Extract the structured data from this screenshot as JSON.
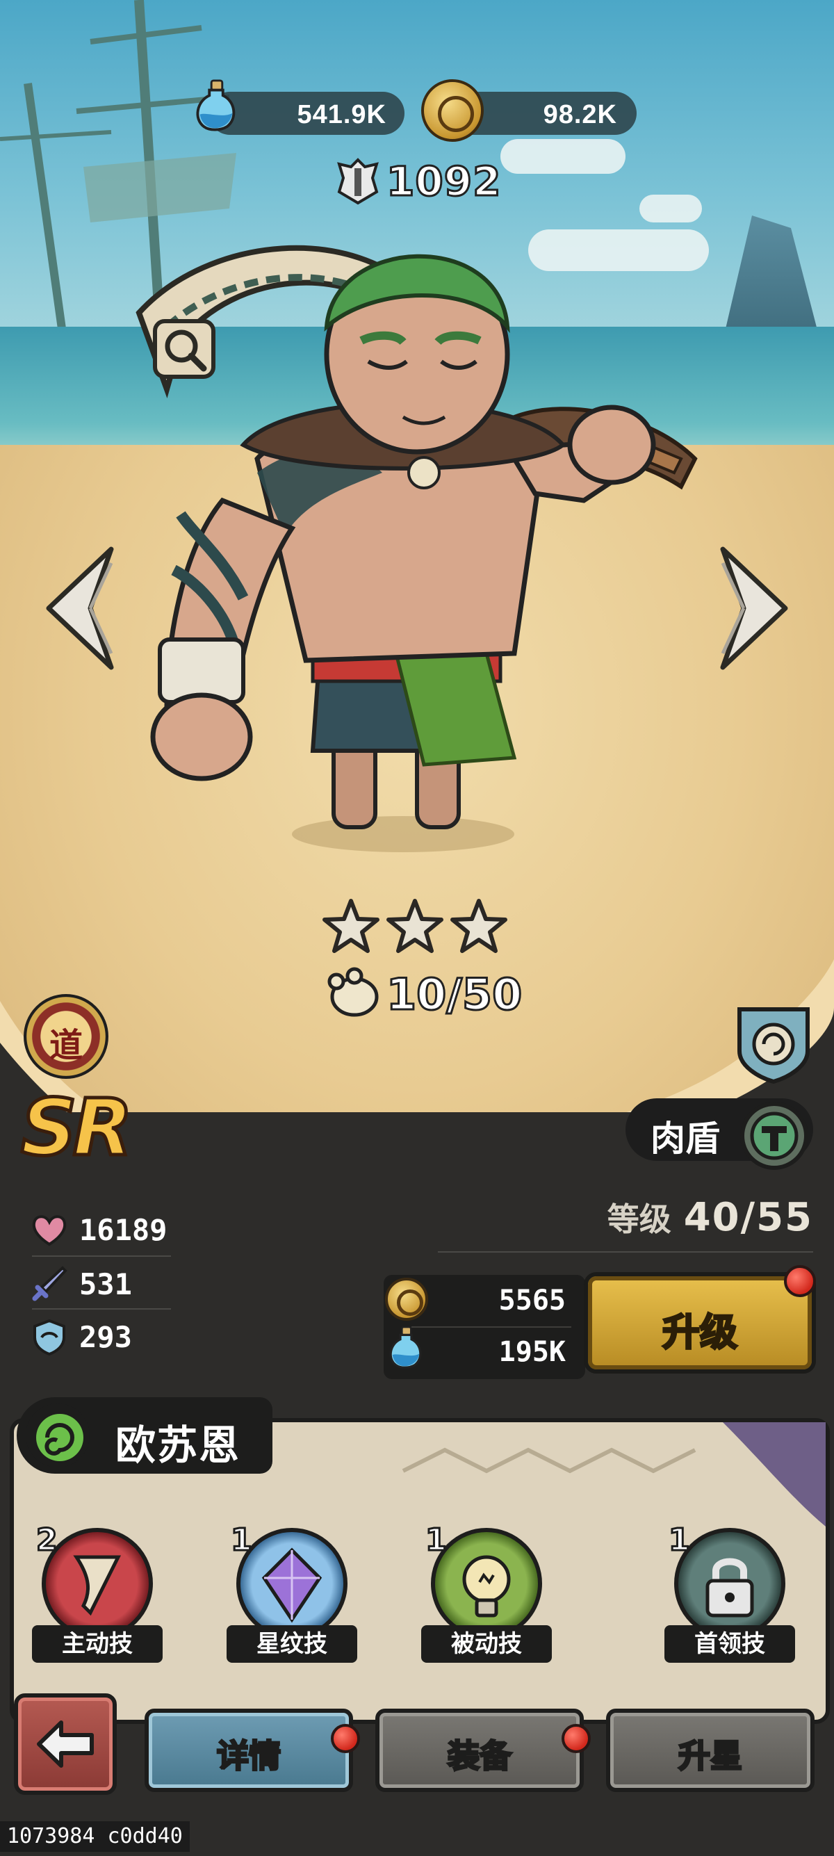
{
  "currencies": {
    "potion_value": "541.9K",
    "coin_value": "98.2K"
  },
  "hero": {
    "power": "1092",
    "stars": 3,
    "shards": "10/50",
    "faction_badge": "道",
    "rarity": "SR",
    "role": "肉盾",
    "name": "欧苏恩"
  },
  "stats": [
    {
      "icon": "heart-icon",
      "value": "16189"
    },
    {
      "icon": "sword-icon",
      "value": "531"
    },
    {
      "icon": "armor-icon",
      "value": "293"
    }
  ],
  "level": {
    "label": "等级",
    "value": "40/55"
  },
  "upgrade": {
    "coin_cost": "5565",
    "potion_cost": "195K",
    "button_label": "升级"
  },
  "skills": [
    {
      "level": "2",
      "label": "主动技",
      "icon": "horn-icon"
    },
    {
      "level": "1",
      "label": "星纹技",
      "icon": "purple-gem-icon"
    },
    {
      "level": "1",
      "label": "被动技",
      "icon": "lightbulb-icon"
    },
    {
      "level": "1",
      "label": "首领技",
      "icon": "lock-icon"
    }
  ],
  "tabs": [
    {
      "label": "详情",
      "active": true,
      "badge": true
    },
    {
      "label": "装备",
      "active": false,
      "badge": true
    },
    {
      "label": "升星",
      "active": false,
      "badge": false
    }
  ],
  "footer_id": "1073984 c0dd40",
  "colors": {
    "panel": "#2d2c2a",
    "gold": "#e8c04d",
    "active_tab": "#6e9cb3",
    "badge_red": "#d2281c"
  }
}
